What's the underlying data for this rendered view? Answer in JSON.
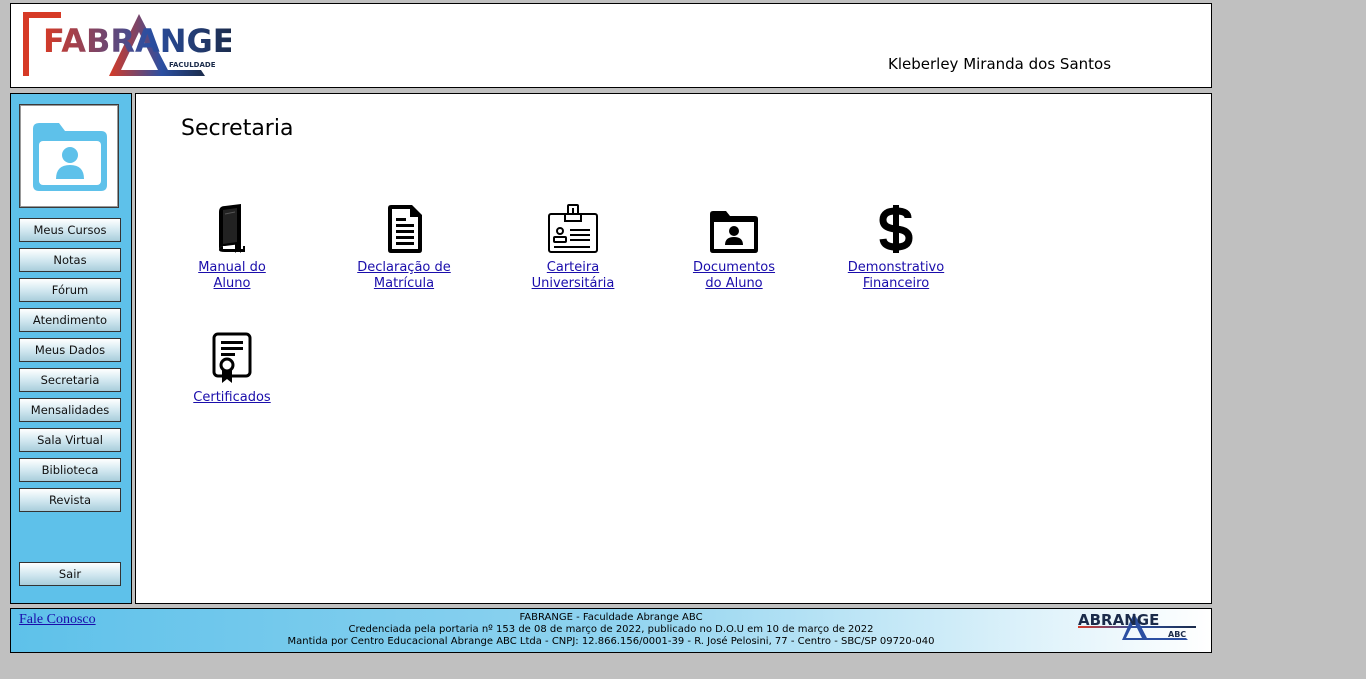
{
  "header": {
    "logo_text": "FABRANGE",
    "logo_subtext": "FACULDADE",
    "user_name": "Kleberley Miranda dos Santos"
  },
  "sidebar": {
    "items": [
      {
        "label": "Meus Cursos"
      },
      {
        "label": "Notas"
      },
      {
        "label": "Fórum"
      },
      {
        "label": "Atendimento"
      },
      {
        "label": "Meus Dados"
      },
      {
        "label": "Secretaria"
      },
      {
        "label": "Mensalidades"
      },
      {
        "label": "Sala Virtual"
      },
      {
        "label": "Biblioteca"
      },
      {
        "label": "Revista"
      }
    ],
    "logout_label": "Sair"
  },
  "main": {
    "title": "Secretaria",
    "tiles": [
      {
        "line1": "Manual do",
        "line2": "Aluno",
        "icon": "book-icon"
      },
      {
        "line1": "Declaração de",
        "line2": "Matrícula",
        "icon": "document-icon"
      },
      {
        "line1": "Carteira",
        "line2": "Universitária",
        "icon": "id-card-icon"
      },
      {
        "line1": "Documentos",
        "line2": "do Aluno",
        "icon": "folder-user-icon"
      },
      {
        "line1": "Demonstrativo",
        "line2": "Financeiro",
        "icon": "dollar-icon"
      },
      {
        "line1": "Certificados",
        "line2": "",
        "icon": "certificate-icon"
      }
    ]
  },
  "footer": {
    "contact_label": "Fale Conosco",
    "line1": "FABRANGE - Faculdade Abrange ABC",
    "line2": "Credenciada pela portaria nº 153 de 08 de março de 2022, publicado no D.O.U em 10 de março de 2022",
    "line3": "Mantida por Centro Educacional Abrange ABC Ltda - CNPJ: 12.866.156/0001-39 - R. José Pelosini, 77 - Centro - SBC/SP 09720-040",
    "logo_text": "ABRANGE",
    "logo_subtext": "ABC"
  },
  "colors": {
    "sidebar_bg": "#5ec1ea",
    "link": "#1a0dab",
    "brand_red": "#d63a26",
    "brand_blue": "#2b4fa2",
    "brand_dark": "#1b2b4a"
  }
}
